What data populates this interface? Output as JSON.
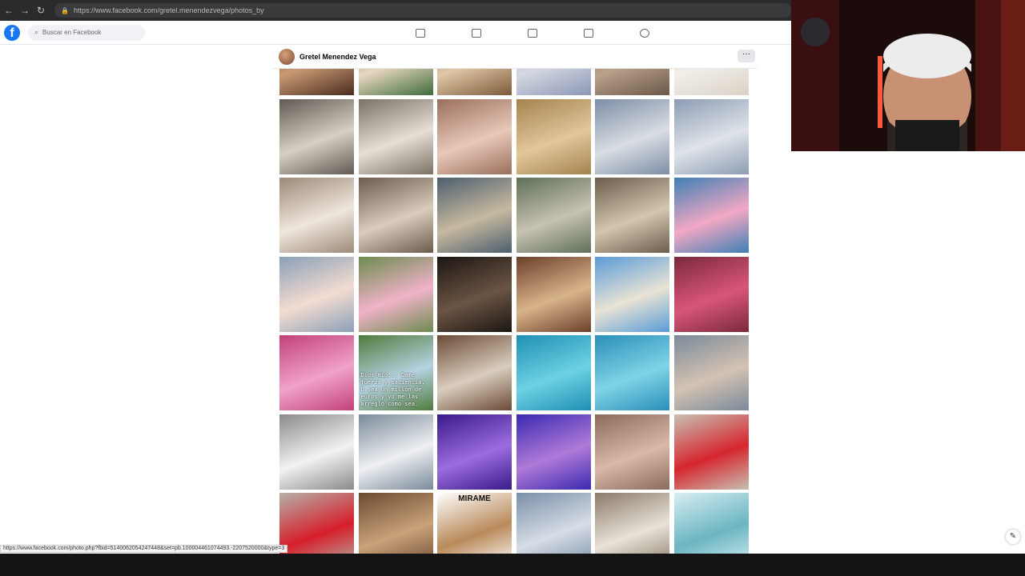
{
  "browser": {
    "url": "https://www.facebook.com/gretel.menendezvega/photos_by",
    "back_icon": "back-arrow-icon",
    "forward_icon": "forward-arrow-icon",
    "reload_icon": "reload-icon"
  },
  "header": {
    "search_placeholder": "Buscar en Facebook",
    "nav": [
      "home-icon",
      "pages-icon",
      "watch-icon",
      "marketplace-icon",
      "groups-icon"
    ]
  },
  "profile": {
    "name": "Gretel Menendez Vega",
    "more_label": "···"
  },
  "photos": {
    "items": [
      {
        "c1": "#4a2b1f",
        "c2": "#c89a72"
      },
      {
        "c1": "#3d6b3a",
        "c2": "#e9d7c1"
      },
      {
        "c1": "#7b5a3a",
        "c2": "#e0c7a5"
      },
      {
        "c1": "#8c97b5",
        "c2": "#d5d8e2"
      },
      {
        "c1": "#6b5748",
        "c2": "#b9a28b"
      },
      {
        "c1": "#d9d2c6",
        "c2": "#f2eee8"
      },
      {
        "c1": "#5f5a52",
        "c2": "#d6cfc4"
      },
      {
        "c1": "#7a7066",
        "c2": "#e6dfd5"
      },
      {
        "c1": "#9a6f5c",
        "c2": "#e8c8b8"
      },
      {
        "c1": "#a4824e",
        "c2": "#e2c79a"
      },
      {
        "c1": "#7d8ea6",
        "c2": "#d9dde3"
      },
      {
        "c1": "#8c9cb3",
        "c2": "#dfe3e9"
      },
      {
        "c1": "#9c8a78",
        "c2": "#efe6dc"
      },
      {
        "c1": "#6b5b4c",
        "c2": "#d8ccbd"
      },
      {
        "c1": "#4d5e6e",
        "c2": "#c6b99f"
      },
      {
        "c1": "#5e6f58",
        "c2": "#c7c2b2"
      },
      {
        "c1": "#6a5c4a",
        "c2": "#d3c6b0"
      },
      {
        "c1": "#3f7fb4",
        "c2": "#f2a8c4"
      },
      {
        "c1": "#8aa0b8",
        "c2": "#f3dcd0"
      },
      {
        "c1": "#6d8b4e",
        "c2": "#f0b3c9"
      },
      {
        "c1": "#1c1612",
        "c2": "#6a5444"
      },
      {
        "c1": "#6b3f2a",
        "c2": "#d8b48a"
      },
      {
        "c1": "#5a9bd6",
        "c2": "#e9e3d5"
      },
      {
        "c1": "#7a2a3a",
        "c2": "#d8557a"
      },
      {
        "c1": "#c2417a",
        "c2": "#f0a2c9"
      },
      {
        "c1": "#4f7a3b",
        "c2": "#b5d2e0"
      },
      {
        "c1": "#6b4a36",
        "c2": "#d9cdbd"
      },
      {
        "c1": "#1f8fb3",
        "c2": "#6cd1e3"
      },
      {
        "c1": "#2a8fb8",
        "c2": "#7fd3e6"
      },
      {
        "c1": "#7a8a9a",
        "c2": "#d4c2b2"
      },
      {
        "c1": "#8a8a8a",
        "c2": "#f2f2f2"
      },
      {
        "c1": "#7a8a9a",
        "c2": "#eef0f2"
      },
      {
        "c1": "#3a1a8a",
        "c2": "#9b6ce0"
      },
      {
        "c1": "#3a2ab0",
        "c2": "#b07ad8"
      },
      {
        "c1": "#8a6a5a",
        "c2": "#d9b8a8"
      },
      {
        "c1": "#c8c0b2",
        "c2": "#d6262e"
      },
      {
        "c1": "#b5b0a8",
        "c2": "#d61f2a"
      },
      {
        "c1": "#6b4a30",
        "c2": "#c9a27a"
      },
      {
        "c1": "#ffffff",
        "c2": "#b98a5a"
      },
      {
        "c1": "#7a8fa8",
        "c2": "#d6dde6"
      },
      {
        "c1": "#8a7a6a",
        "c2": "#e8e2d8"
      },
      {
        "c1": "#d8eef2",
        "c2": "#6bb5c2"
      }
    ],
    "caption_text": "Dios mío... Dame fuerza y paciencia. O sea un millón de euros y yo me las arreglo como sea.",
    "mirame_text": "MIRAME"
  },
  "status": {
    "link": "https://www.facebook.com/photo.php?fbid=5140062054247448&set=pb.100004461074493.-2207520000&type=3"
  },
  "colors": {
    "brand": "#1877f2",
    "browser_chrome": "#2b2b2e",
    "page_bg": "#ffffff"
  }
}
